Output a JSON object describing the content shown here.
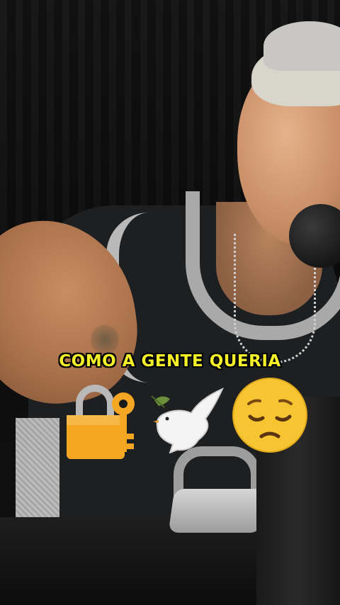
{
  "caption": {
    "text": "COMO A GENTE QUERIA",
    "color": "#f3f02a"
  },
  "emojis": [
    "lock-with-key-icon",
    "dove-icon",
    "pensive-face-icon"
  ],
  "scene": {
    "subject": "podcast-guest-at-microphone",
    "accent_colors": {
      "jersey": "#1d1f21",
      "jersey_trim": "#b9b9b9",
      "caption_outline": "#000000"
    }
  }
}
